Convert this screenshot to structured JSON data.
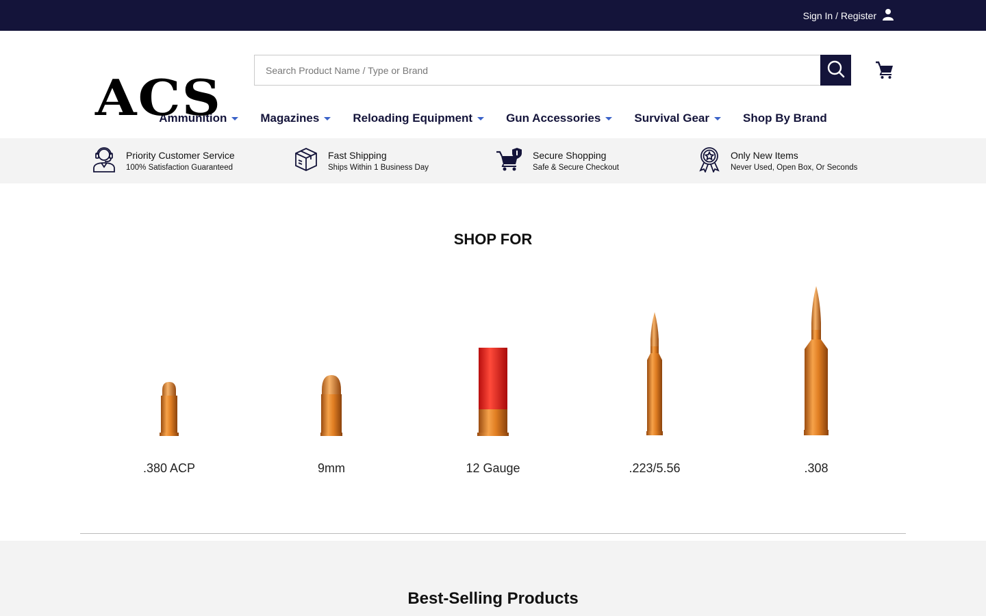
{
  "topbar": {
    "signin_label": "Sign In / Register"
  },
  "header": {
    "logo_text": "ACS",
    "search_placeholder": "Search Product Name / Type or Brand"
  },
  "nav": {
    "items": [
      {
        "label": "Ammunition",
        "dropdown": true
      },
      {
        "label": "Magazines",
        "dropdown": true
      },
      {
        "label": "Reloading Equipment",
        "dropdown": true
      },
      {
        "label": "Gun Accessories",
        "dropdown": true
      },
      {
        "label": "Survival Gear",
        "dropdown": true
      },
      {
        "label": "Shop By Brand",
        "dropdown": false
      }
    ]
  },
  "features": [
    {
      "icon": "customer-service-icon",
      "title": "Priority Customer Service",
      "subtitle": "100% Satisfaction Guaranteed"
    },
    {
      "icon": "shipping-box-icon",
      "title": "Fast Shipping",
      "subtitle": "Ships Within 1 Business Day"
    },
    {
      "icon": "secure-cart-icon",
      "title": "Secure Shopping",
      "subtitle": "Safe & Secure Checkout"
    },
    {
      "icon": "award-ribbon-icon",
      "title": "Only New Items",
      "subtitle": "Never Used, Open Box, Or Seconds"
    }
  ],
  "shop_for": {
    "title": "SHOP FOR",
    "calibers": [
      {
        "label": ".380 ACP",
        "icon": "pistol-round-short-icon"
      },
      {
        "label": "9mm",
        "icon": "pistol-round-icon"
      },
      {
        "label": "12 Gauge",
        "icon": "shotgun-shell-icon"
      },
      {
        "label": ".223/5.56",
        "icon": "rifle-round-icon"
      },
      {
        "label": ".308",
        "icon": "rifle-round-large-icon"
      }
    ]
  },
  "best_selling": {
    "title": "Best-Selling Products"
  },
  "colors": {
    "navy": "#14143a",
    "accent": "#3a62c8",
    "brass": "#d9801f",
    "shell_red": "#e02020"
  }
}
